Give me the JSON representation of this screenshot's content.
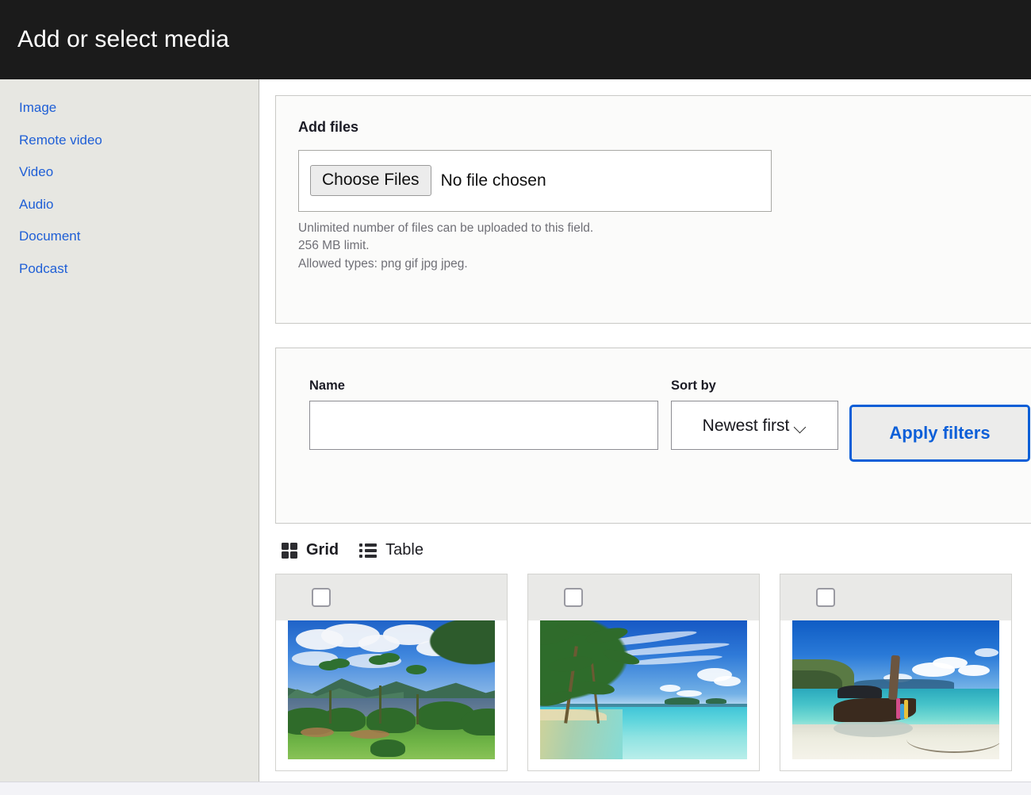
{
  "dialog": {
    "title": "Add or select media"
  },
  "sidebar": {
    "items": [
      {
        "label": "Image"
      },
      {
        "label": "Remote video"
      },
      {
        "label": "Video"
      },
      {
        "label": "Audio"
      },
      {
        "label": "Document"
      },
      {
        "label": "Podcast"
      }
    ]
  },
  "add_files": {
    "title": "Add files",
    "choose_button_label": "Choose Files",
    "file_status": "No file chosen",
    "help_line_1": "Unlimited number of files can be uploaded to this field.",
    "help_line_2": "256 MB limit.",
    "help_line_3": "Allowed types: png gif jpg jpeg."
  },
  "filters": {
    "name_label": "Name",
    "name_value": "",
    "name_placeholder": "",
    "sort_label": "Sort by",
    "sort_value": "Newest first",
    "sort_options": [
      "Newest first"
    ],
    "apply_label": "Apply filters"
  },
  "view_switch": {
    "grid_label": "Grid",
    "table_label": "Table",
    "active": "Grid",
    "grid_icon": "grid-icon",
    "table_icon": "list-icon"
  },
  "media_items": [
    {
      "scene": "island-mountain-landscape",
      "selected": false
    },
    {
      "scene": "palm-trees-turquoise-lagoon",
      "selected": false
    },
    {
      "scene": "longtail-boat-white-beach",
      "selected": false
    }
  ],
  "colors": {
    "titlebar_bg": "#1b1b1b",
    "sidebar_bg": "#e7e7e2",
    "link_blue": "#1f5fd6",
    "accent_blue": "#0b5ed7",
    "panel_bg": "#fbfbfa"
  }
}
